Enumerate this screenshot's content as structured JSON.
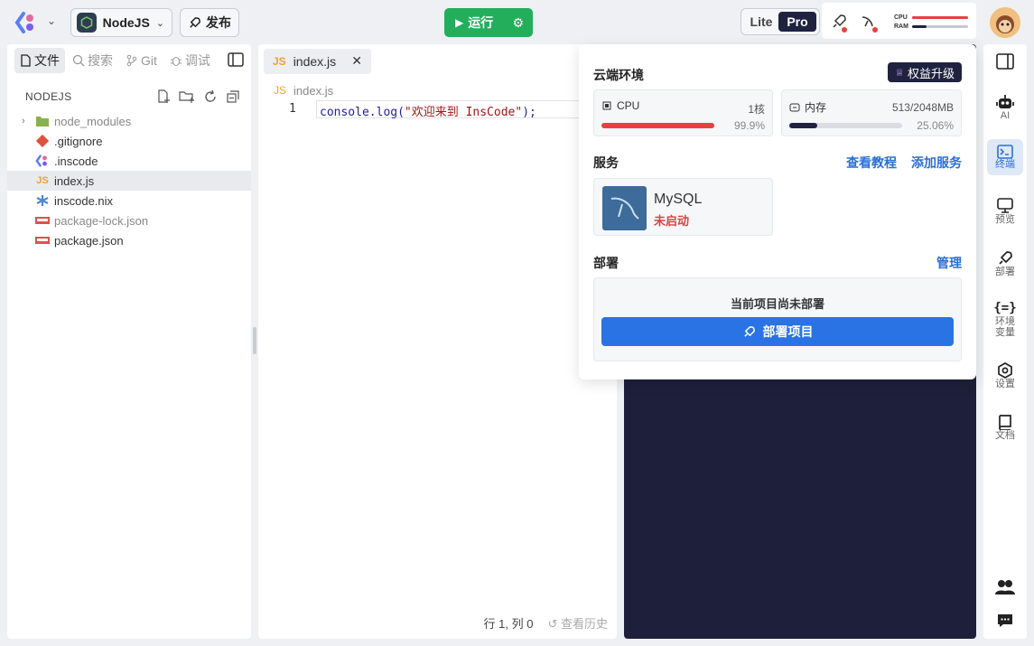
{
  "header": {
    "project_name": "NodeJS",
    "publish_label": "发布",
    "run_label": "运行",
    "mode_lite": "Lite",
    "mode_pro": "Pro",
    "cpu_label": "CPU",
    "ram_label": "RAM",
    "cpu_meter": 0.999,
    "ram_meter": 0.25,
    "colors": {
      "run": "#23ae5b",
      "dark": "#1f2340",
      "accent": "#2a73e4",
      "danger": "#e84040"
    }
  },
  "left_tabs": [
    {
      "label": "文件",
      "icon": "file-icon"
    },
    {
      "label": "搜索",
      "icon": "search-icon"
    },
    {
      "label": "Git",
      "icon": "git-icon"
    },
    {
      "label": "调试",
      "icon": "bug-icon"
    }
  ],
  "explorer": {
    "title": "NODEJS",
    "files": [
      {
        "name": "node_modules",
        "type": "folder"
      },
      {
        "name": ".gitignore",
        "type": "git"
      },
      {
        "name": ".inscode",
        "type": "inscode"
      },
      {
        "name": "index.js",
        "type": "js"
      },
      {
        "name": "inscode.nix",
        "type": "nix"
      },
      {
        "name": "package-lock.json",
        "type": "npm"
      },
      {
        "name": "package.json",
        "type": "npm"
      }
    ]
  },
  "editor": {
    "tab_label": "index.js",
    "tab_badge": "JS",
    "breadcrumb_badge": "JS",
    "breadcrumb": "index.js",
    "line_number": "1",
    "code_prefix": "console.log(",
    "code_string": "\"欢迎来到 InsCode\"",
    "code_suffix": ");",
    "cursor_pos": "行 1, 列 0",
    "history_label": "查看历史"
  },
  "popup": {
    "cloud_title": "云端环境",
    "upgrade_label": "权益升级",
    "cpu": {
      "label": "CPU",
      "value": "1核",
      "percent": "99.9%",
      "fill": 0.999
    },
    "mem": {
      "label": "内存",
      "value": "513/2048MB",
      "percent": "25.06%",
      "fill": 0.2506
    },
    "services_title": "服务",
    "tutorial_link": "查看教程",
    "add_service_link": "添加服务",
    "service": {
      "name": "MySQL",
      "status": "未启动"
    },
    "deploy_title": "部署",
    "manage_link": "管理",
    "deploy_msg": "当前项目尚未部署",
    "deploy_button": "部署项目"
  },
  "right_bar": [
    {
      "label": "AI",
      "icon": "robot-icon"
    },
    {
      "label": "终端",
      "icon": "terminal-icon",
      "active": true
    },
    {
      "label": "预览",
      "icon": "monitor-icon"
    },
    {
      "label": "部署",
      "icon": "rocket-icon"
    },
    {
      "label": "环境变量",
      "icon": "braces-icon"
    },
    {
      "label": "设置",
      "icon": "settings-icon"
    },
    {
      "label": "文档",
      "icon": "book-icon"
    }
  ]
}
